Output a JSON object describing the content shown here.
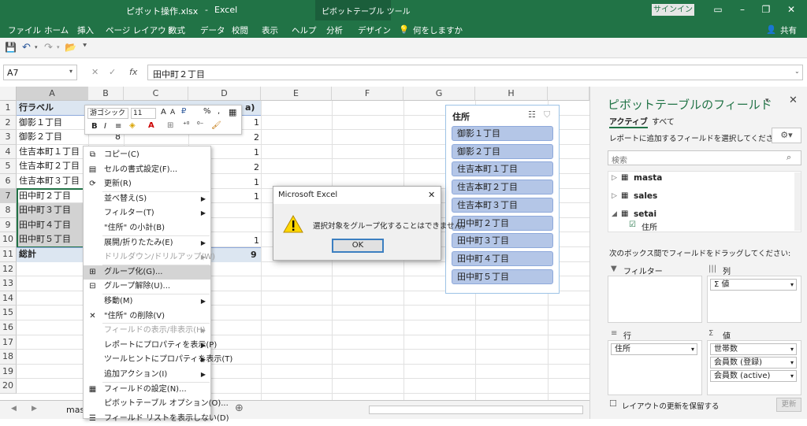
{
  "title": {
    "file": "ピボット操作.xlsx",
    "separator": "-",
    "app": "Excel",
    "context_tools": "ピボットテーブル ツール",
    "signin": "サインイン"
  },
  "ribbon": {
    "tabs": [
      "ファイル",
      "ホーム",
      "挿入",
      "ページ レイアウト",
      "数式",
      "データ",
      "校閲",
      "表示",
      "ヘルプ",
      "分析",
      "デザイン"
    ],
    "tell_me": "何をしますか",
    "share": "共有"
  },
  "formula": {
    "namebox": "A7",
    "content": "田中町２丁目",
    "fx": "fx"
  },
  "grid": {
    "columns": [
      "A",
      "B",
      "C",
      "D",
      "E",
      "F",
      "G",
      "H"
    ],
    "rows": [
      "1",
      "2",
      "3",
      "4",
      "5",
      "6",
      "7",
      "8",
      "9",
      "10",
      "11",
      "12",
      "13",
      "14",
      "15",
      "16",
      "17",
      "18",
      "19",
      "20"
    ],
    "colA": [
      "行ラベル",
      "御影１丁目",
      "御影２丁目",
      "住吉本町１丁目",
      "住吉本町２丁目",
      "住吉本町３丁目",
      "田中町２丁目",
      "田中町３丁目",
      "田中町４丁目",
      "田中町５丁目",
      "総計"
    ],
    "colB": [
      "",
      "8",
      "8",
      "",
      "",
      "",
      "",
      "",
      "",
      "",
      ""
    ],
    "colC": [
      "",
      "",
      "2",
      "",
      "",
      "",
      "",
      "",
      "",
      "",
      ""
    ],
    "colD": [
      "a)",
      "1",
      "2",
      "1",
      "2",
      "1",
      "1",
      "",
      "",
      "1",
      "9"
    ]
  },
  "mini_toolbar": {
    "font": "游ゴシック",
    "size": "11",
    "bold": "B",
    "italic": "I",
    "percent": "%",
    "comma": ","
  },
  "context_menu": {
    "items": [
      {
        "label": "コピー(C)",
        "icon": "copy-icon",
        "disabled": false,
        "submenu": false
      },
      {
        "label": "セルの書式設定(F)...",
        "icon": "format-cells-icon",
        "disabled": false,
        "submenu": false
      },
      {
        "label": "更新(R)",
        "icon": "refresh-icon",
        "disabled": false,
        "submenu": false
      },
      {
        "label": "並べ替え(S)",
        "icon": "",
        "disabled": false,
        "submenu": true
      },
      {
        "label": "フィルター(T)",
        "icon": "",
        "disabled": false,
        "submenu": true
      },
      {
        "label": "\"住所\" の小計(B)",
        "icon": "",
        "disabled": false,
        "submenu": false
      },
      {
        "label": "展開/折りたたみ(E)",
        "icon": "",
        "disabled": false,
        "submenu": true
      },
      {
        "label": "ドリルダウン/ドリルアップ(W)",
        "icon": "",
        "disabled": true,
        "submenu": true
      },
      {
        "label": "グループ化(G)...",
        "icon": "group-icon",
        "disabled": false,
        "submenu": false
      },
      {
        "label": "グループ解除(U)...",
        "icon": "ungroup-icon",
        "disabled": false,
        "submenu": false
      },
      {
        "label": "移動(M)",
        "icon": "",
        "disabled": false,
        "submenu": true
      },
      {
        "label": "\"住所\" の削除(V)",
        "icon": "delete-x-icon",
        "disabled": false,
        "submenu": false
      },
      {
        "label": "フィールドの表示/非表示(H)",
        "icon": "",
        "disabled": true,
        "submenu": true
      },
      {
        "label": "レポートにプロパティを表示(P)",
        "icon": "",
        "disabled": false,
        "submenu": true
      },
      {
        "label": "ツールヒントにプロパティを表示(T)",
        "icon": "",
        "disabled": false,
        "submenu": true
      },
      {
        "label": "追加アクション(I)",
        "icon": "",
        "disabled": false,
        "submenu": true
      },
      {
        "label": "フィールドの設定(N)...",
        "icon": "field-settings-icon",
        "disabled": false,
        "submenu": false
      },
      {
        "label": "ピボットテーブル オプション(O)...",
        "icon": "",
        "disabled": false,
        "submenu": false
      },
      {
        "label": "フィールド リストを表示しない(D)",
        "icon": "field-list-icon",
        "disabled": false,
        "submenu": false
      }
    ]
  },
  "slicer": {
    "title": "住所",
    "items": [
      "御影１丁目",
      "御影２丁目",
      "住吉本町１丁目",
      "住吉本町２丁目",
      "住吉本町３丁目",
      "田中町２丁目",
      "田中町３丁目",
      "田中町４丁目",
      "田中町５丁目"
    ]
  },
  "dialog": {
    "title": "Microsoft Excel",
    "message": "選択対象をグループ化することはできません。",
    "ok": "OK"
  },
  "pivot_pane": {
    "title": "ピボットテーブルのフィールド",
    "tab_active": "アクティブ",
    "tab_all": "すべて",
    "instruction": "レポートに追加するフィールドを選択してください:",
    "search_placeholder": "検索",
    "tables": [
      "masta",
      "sales",
      "setai"
    ],
    "checked_field": "住所",
    "drag_instruction": "次のボックス間でフィールドをドラッグしてください:",
    "filter_label": "フィルター",
    "columns_label": "列",
    "rows_label": "行",
    "values_label": "値",
    "columns_field": "Σ 値",
    "rows_field": "住所",
    "values_fields": [
      "世帯数",
      "会員数 (登録)",
      "会員数 (active)"
    ],
    "defer_label": "レイアウトの更新を保留する",
    "update_button": "更新"
  },
  "sheetbar": {
    "tab": "mast"
  },
  "colors": {
    "excel_green": "#217346",
    "slicer_item": "#b4c6e7",
    "selection": "#d4d4d4"
  }
}
